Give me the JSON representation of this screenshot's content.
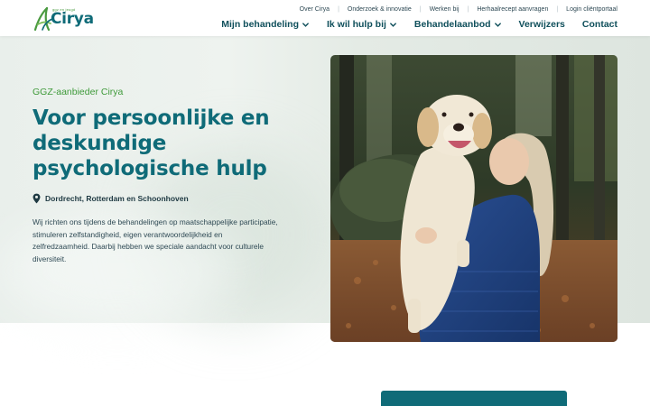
{
  "brand": {
    "name": "Cirya",
    "tagline": "ggz en jeugd",
    "colors": {
      "teal": "#0f6b78",
      "green": "#3f9a3a"
    }
  },
  "topnav": {
    "items": [
      {
        "label": "Over Cirya"
      },
      {
        "label": "Onderzoek & innovatie"
      },
      {
        "label": "Werken bij"
      },
      {
        "label": "Herhaalrecept aanvragen"
      },
      {
        "label": "Login cliëntportaal"
      }
    ]
  },
  "mainnav": {
    "items": [
      {
        "label": "Mijn behandeling",
        "icon": "chevron-down-icon"
      },
      {
        "label": "Ik wil hulp bij",
        "icon": "chevron-down-icon"
      },
      {
        "label": "Behandelaanbod",
        "icon": "chevron-down-icon"
      },
      {
        "label": "Verwijzers"
      },
      {
        "label": "Contact"
      }
    ]
  },
  "hero": {
    "eyebrow": "GGZ-aanbieder Cirya",
    "headline_lines": [
      "Voor persoonlijke en",
      "deskundige",
      "psychologische hulp"
    ],
    "location": "Dordrecht, Rotterdam en Schoonhoven",
    "location_icon": "map-pin-icon",
    "intro": "Wij richten ons tijdens de behandelingen op maatschappelijke participatie, stimuleren zelfstandigheid, eigen verantwoordelijkheid en zelfredzaamheid. Daarbij hebben we speciale aandacht voor culturele diversiteit."
  }
}
